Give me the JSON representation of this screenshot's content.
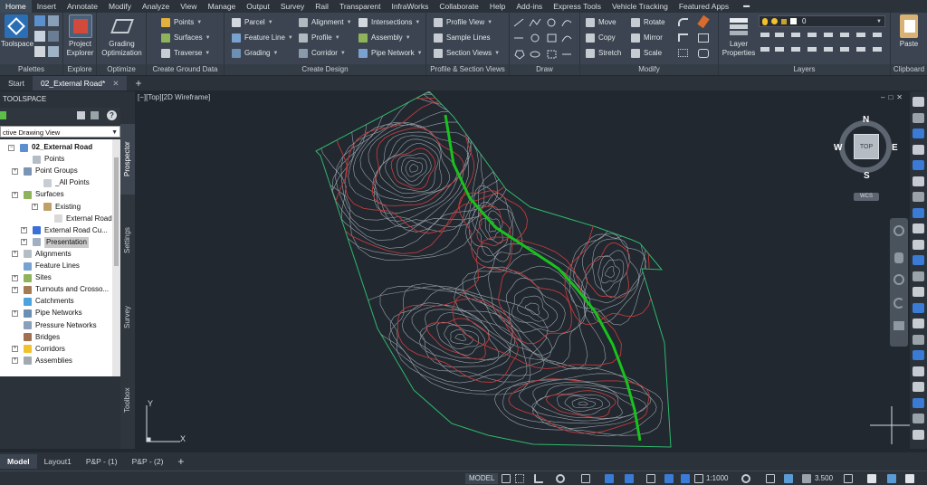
{
  "menu": {
    "items": [
      "Home",
      "Insert",
      "Annotate",
      "Modify",
      "Analyze",
      "View",
      "Manage",
      "Output",
      "Survey",
      "Rail",
      "Transparent",
      "InfraWorks",
      "Collaborate",
      "Help",
      "Add-ins",
      "Express Tools",
      "Vehicle Tracking",
      "Featured Apps"
    ]
  },
  "ribbon": {
    "palettes": {
      "toolspace": "Toolspace",
      "title": "Palettes"
    },
    "explore": {
      "project_explorer_l1": "Project",
      "project_explorer_l2": "Explorer",
      "title": "Explore"
    },
    "optimize": {
      "grading_l1": "Grading",
      "grading_l2": "Optimization",
      "title": "Optimize"
    },
    "ground": {
      "points": "Points",
      "surfaces": "Surfaces",
      "traverse": "Traverse",
      "title": "Create Ground Data"
    },
    "design": {
      "parcel": "Parcel",
      "feature_line": "Feature Line",
      "grading": "Grading",
      "alignment": "Alignment",
      "profile": "Profile",
      "corridor": "Corridor",
      "intersections": "Intersections",
      "assembly": "Assembly",
      "pipe_network": "Pipe Network",
      "title": "Create Design"
    },
    "views": {
      "profile_view": "Profile View",
      "sample_lines": "Sample Lines",
      "section_views": "Section Views",
      "title": "Profile & Section Views"
    },
    "draw": {
      "title": "Draw"
    },
    "modify": {
      "move": "Move",
      "rotate": "Rotate",
      "copy": "Copy",
      "mirror": "Mirror",
      "stretch": "Stretch",
      "scale": "Scale",
      "title": "Modify"
    },
    "layers": {
      "layer_properties_l1": "Layer",
      "layer_properties_l2": "Properties",
      "current_layer": "0",
      "title": "Layers"
    },
    "clipboard": {
      "paste": "Paste",
      "title": "Clipboard"
    }
  },
  "doc_tabs": {
    "start": "Start",
    "active": "02_External Road*"
  },
  "toolspace": {
    "title": "TOOLSPACE",
    "view_combo": "ctive Drawing View",
    "side_tabs": [
      "Prospector",
      "Settings",
      "Survey",
      "Toolbox"
    ],
    "tree": [
      {
        "label": "02_External Road",
        "bold": true
      },
      {
        "label": "Points"
      },
      {
        "label": "Point Groups"
      },
      {
        "label": "_All Points"
      },
      {
        "label": "Surfaces"
      },
      {
        "label": "Existing"
      },
      {
        "label": "External Road..."
      },
      {
        "label": "External Road Cu..."
      },
      {
        "label": "Presentation",
        "selected": true
      },
      {
        "label": "Alignments"
      },
      {
        "label": "Feature Lines"
      },
      {
        "label": "Sites"
      },
      {
        "label": "Turnouts and Crosso..."
      },
      {
        "label": "Catchments"
      },
      {
        "label": "Pipe Networks"
      },
      {
        "label": "Pressure Networks"
      },
      {
        "label": "Bridges"
      },
      {
        "label": "Corridors"
      },
      {
        "label": "Assemblies"
      }
    ]
  },
  "viewport": {
    "label": "[−][Top][2D Wireframe]",
    "viewcube": {
      "top": "TOP",
      "n": "N",
      "s": "S",
      "e": "E",
      "w": "W",
      "ucs": "WCS"
    },
    "ucs_y": "Y",
    "ucs_x": "X",
    "colors": {
      "boundary": "#2fb86a",
      "alignment": "#19c21c",
      "major": "#c23a3a",
      "minor": "#9aa2aa"
    }
  },
  "layout_tabs": [
    "Model",
    "Layout1",
    "P&P - (1)",
    "P&P - (2)"
  ],
  "status": {
    "model": "MODEL",
    "scale": "1:1000",
    "value": "3.500"
  }
}
